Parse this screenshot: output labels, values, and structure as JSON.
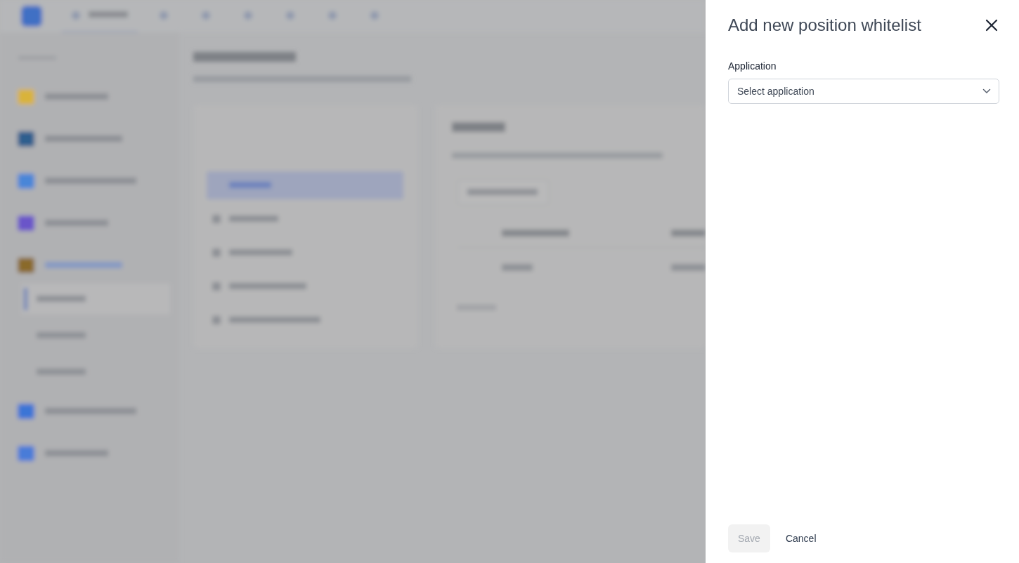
{
  "drawer": {
    "title": "Add new position whitelist",
    "field": {
      "label": "Application",
      "placeholder": "Select application"
    },
    "buttons": [
      {
        "label": "Save",
        "kind": "primary",
        "disabled": true
      },
      {
        "label": "Cancel",
        "kind": "text",
        "disabled": false
      }
    ]
  }
}
